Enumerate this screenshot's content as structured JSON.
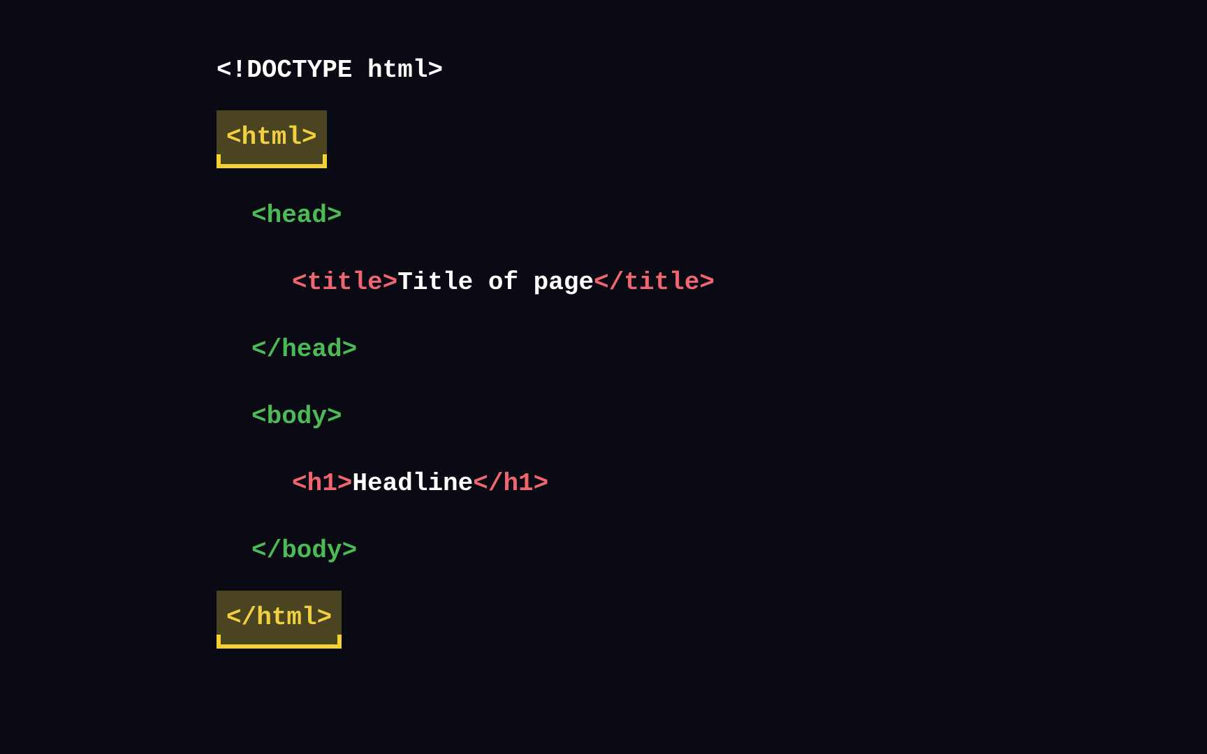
{
  "code": {
    "line1": "<!DOCTYPE html>",
    "line2": "<html>",
    "line3": "<head>",
    "line4_open": "<title>",
    "line4_content": " Title of page ",
    "line4_close": "</title>",
    "line5": "</head>",
    "line6": "<body>",
    "line7_open": "<h1>",
    "line7_content": " Headline ",
    "line7_close": "</h1>",
    "line8": "</body>",
    "line9": "</html>"
  }
}
